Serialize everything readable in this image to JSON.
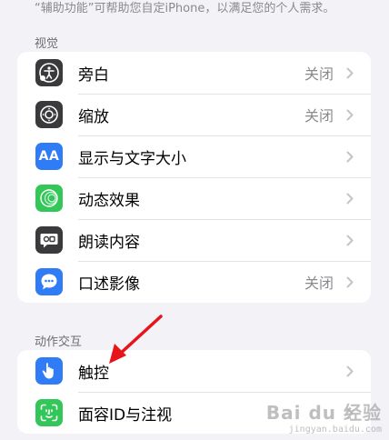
{
  "header": {
    "description": "“辅助功能”可帮助您自定iPhone，以满足您的个人需求。"
  },
  "sections": [
    {
      "title": "视觉",
      "items": [
        {
          "label": "旁白",
          "value": "关闭",
          "icon": "voiceover-icon",
          "icon_color": "#3a3a3c"
        },
        {
          "label": "缩放",
          "value": "关闭",
          "icon": "zoom-icon",
          "icon_color": "#3a3a3c"
        },
        {
          "label": "显示与文字大小",
          "value": "",
          "icon": "text-size-icon",
          "icon_glyph": "AA",
          "icon_color": "#2f7cf6"
        },
        {
          "label": "动态效果",
          "value": "",
          "icon": "motion-icon",
          "icon_color": "#33c759"
        },
        {
          "label": "朗读内容",
          "value": "",
          "icon": "spoken-content-icon",
          "icon_color": "#3a3a3c"
        },
        {
          "label": "口述影像",
          "value": "关闭",
          "icon": "audio-description-icon",
          "icon_color": "#2f7cf6"
        }
      ]
    },
    {
      "title": "动作交互",
      "items": [
        {
          "label": "触控",
          "value": "",
          "icon": "touch-hand-icon",
          "icon_color": "#2f7cf6"
        },
        {
          "label": "面容ID与注视",
          "value": "",
          "icon": "face-id-icon",
          "icon_color": "#33c759"
        }
      ]
    }
  ],
  "watermark": {
    "main": "Bai du 经验",
    "sub": "jingyan.baidu.com"
  },
  "colors": {
    "background": "#f2f2f7",
    "annotation_arrow": "#e8141c"
  }
}
